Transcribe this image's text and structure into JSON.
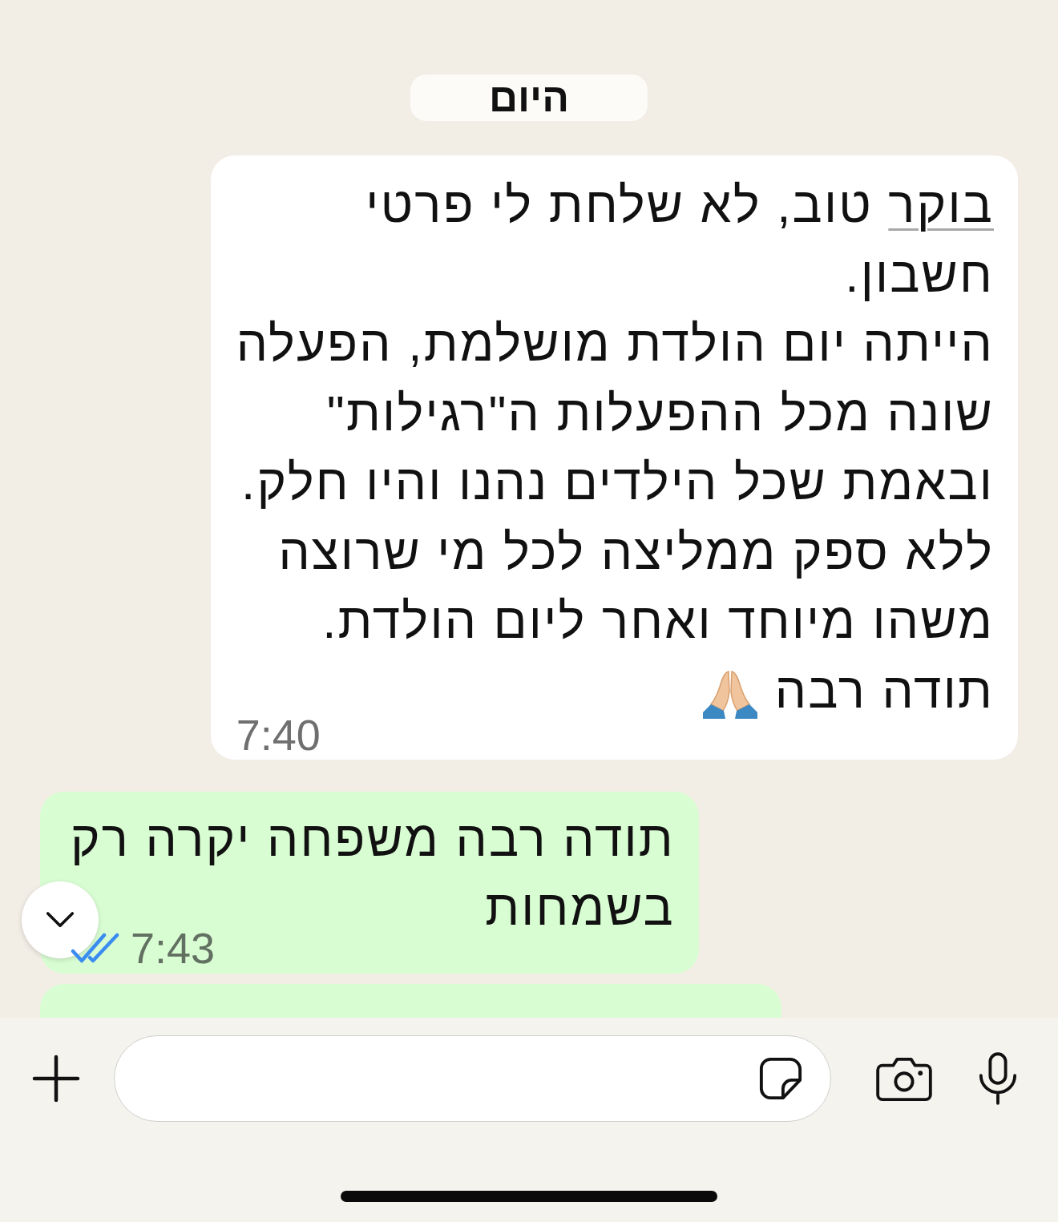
{
  "date_divider": {
    "label": "היום"
  },
  "messages": [
    {
      "kind": "incoming",
      "cut_off": false,
      "lines": [
        [
          {
            "kind": "link",
            "text": "בוקר"
          },
          {
            "kind": "plain",
            "text": " טוב, לא שלחת לי פרטי"
          }
        ],
        [
          {
            "kind": "plain",
            "text": "חשבון."
          }
        ],
        [
          {
            "kind": "plain",
            "text": "הייתה יום הולדת מושלמת, הפעלה"
          }
        ],
        [
          {
            "kind": "plain",
            "text": "שונה מכל ההפעלות ה\"רגילות\""
          }
        ],
        [
          {
            "kind": "plain",
            "text": "ובאמת שכל הילדים נהנו והיו חלק."
          }
        ],
        [
          {
            "kind": "plain",
            "text": "ללא ספק ממליצה לכל מי שרוצה"
          }
        ],
        [
          {
            "kind": "plain",
            "text": "משהו מיוחד ואחר ליום הולדת."
          }
        ],
        [
          {
            "kind": "plain",
            "text": "תודה רבה"
          },
          {
            "kind": "emoji"
          }
        ]
      ],
      "time": "7:40"
    },
    {
      "kind": "outgoing",
      "cut_off": false,
      "lines": [
        [
          {
            "kind": "plain",
            "text": "תודה רבה משפחה יקרה רק"
          }
        ],
        [
          {
            "kind": "plain",
            "text": "בשמחות"
          }
        ]
      ],
      "time": "7:43",
      "read": true
    },
    {
      "kind": "outgoing",
      "cut_off": true
    }
  ]
}
